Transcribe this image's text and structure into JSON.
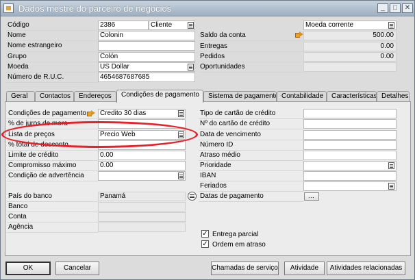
{
  "window": {
    "title": "Dados mestre do parceiro de negócios"
  },
  "header": {
    "code_label": "Código",
    "code_value": "2386",
    "type_value": "Cliente",
    "name_label": "Nome",
    "name_value": "Colonin",
    "foreign_name_label": "Nome estrangeiro",
    "foreign_name_value": "",
    "group_label": "Grupo",
    "group_value": "Colón",
    "currency_label": "Moeda",
    "currency_value": "US Dollar",
    "ruc_label": "Número de R.U.C.",
    "ruc_value": "4654687687685",
    "local_currency_value": "Moeda corrente",
    "balance_label": "Saldo da conta",
    "balance_value": "500.00",
    "deliveries_label": "Entregas",
    "deliveries_value": "0.00",
    "orders_label": "Pedidos",
    "orders_value": "0.00",
    "opportunities_label": "Oportunidades",
    "opportunities_value": ""
  },
  "tabs": [
    {
      "label": "Geral"
    },
    {
      "label": "Contactos"
    },
    {
      "label": "Endereços"
    },
    {
      "label": "Condições de pagamento"
    },
    {
      "label": "Sistema de pagamento"
    },
    {
      "label": "Contabilidade"
    },
    {
      "label": "Características"
    },
    {
      "label": "Detalhes"
    }
  ],
  "payment": {
    "payment_terms_label": "Condições de pagamento",
    "payment_terms_value": "Credito 30 dias",
    "interest_label": "% de juros de mora",
    "interest_value": "",
    "price_list_label": "Lista de preços",
    "price_list_value": "Precio Web",
    "discount_label": "% total de desconto",
    "discount_value": "",
    "credit_limit_label": "Limite de crédito",
    "credit_limit_value": "0.00",
    "commitment_label": "Compromisso máximo",
    "commitment_value": "0.00",
    "dunning_label": "Condição de advertência",
    "dunning_value": "",
    "bank_country_label": "País do banco",
    "bank_country_value": "Panamá",
    "bank_label": "Banco",
    "bank_value": "",
    "account_label": "Conta",
    "account_value": "",
    "branch_label": "Agência",
    "branch_value": "",
    "card_type_label": "Tipo de cartão de crédito",
    "card_type_value": "",
    "card_no_label": "Nº do cartão de crédito",
    "card_no_value": "",
    "expiry_label": "Data de vencimento",
    "expiry_value": "",
    "id_label": "Número ID",
    "id_value": "",
    "avg_delay_label": "Atraso médio",
    "avg_delay_value": "",
    "priority_label": "Prioridade",
    "priority_value": "",
    "iban_label": "IBAN",
    "iban_value": "",
    "holidays_label": "Feriados",
    "holidays_value": "",
    "payment_dates_label": "Datas de pagamento",
    "payment_dates_button": "...",
    "partial_delivery_label": "Entrega parcial",
    "partial_delivery_checked": true,
    "backorder_label": "Ordem em atraso",
    "backorder_checked": true
  },
  "footer": {
    "ok_label": "OK",
    "cancel_label": "Cancelar",
    "service_calls_label": "Chamadas de serviço",
    "activity_label": "Atividade",
    "related_activities_label": "Atividades relacionadas"
  },
  "icons": {
    "arrow_color": "#f0a020",
    "highlight_color": "#e8202a"
  }
}
